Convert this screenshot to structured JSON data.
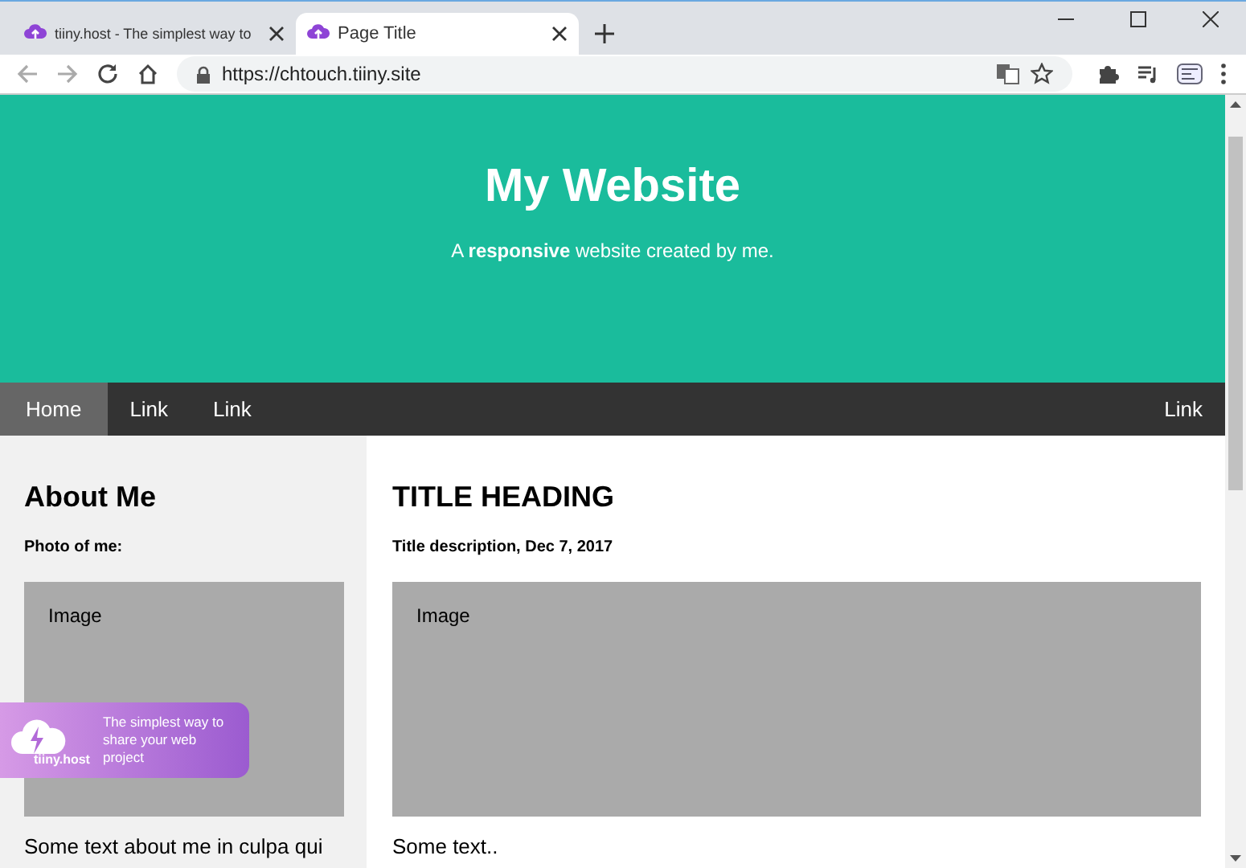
{
  "tabs": [
    {
      "title": "tiiny.host - The simplest way to",
      "selected": false
    },
    {
      "title": "Page Title",
      "selected": true
    }
  ],
  "address_bar": {
    "url": "https://chtouch.tiiny.site"
  },
  "header": {
    "title": "My Website",
    "tagline": "A **responsive** website created by me."
  },
  "navbar": {
    "left_items": [
      {
        "label": "Home",
        "selected": true
      },
      {
        "label": "Link",
        "selected": false
      },
      {
        "label": "Link",
        "selected": false
      }
    ],
    "right_items": [
      {
        "label": "Link",
        "selected": false
      }
    ]
  },
  "sidebar": {
    "heading": "About Me",
    "subheading": "Photo of me:",
    "image_label": "Image",
    "text": "Some text about me in culpa qui"
  },
  "main": {
    "heading": "TITLE HEADING",
    "subheading": "Title description, Dec 7, 2017",
    "image_label": "Image",
    "text": "Some text.."
  },
  "promo_badge": {
    "brand": "tiiny.host",
    "text": "The simplest way to share your web project"
  }
}
